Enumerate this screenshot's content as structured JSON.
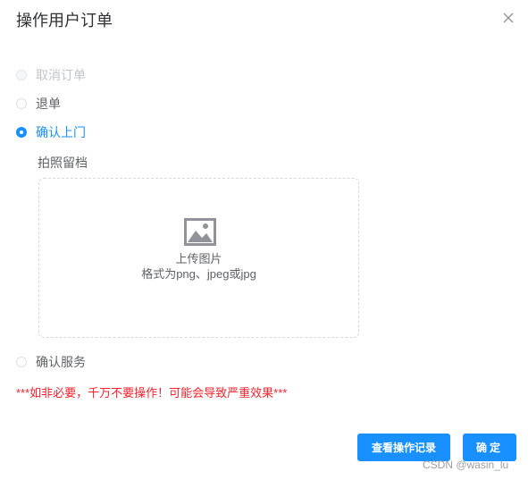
{
  "dialog": {
    "title": "操作用户订单",
    "close_icon": "close-icon"
  },
  "options": [
    {
      "label": "取消订单",
      "state": "disabled"
    },
    {
      "label": "退单",
      "state": "unchecked"
    },
    {
      "label": "确认上门",
      "state": "checked"
    },
    {
      "label": "确认服务",
      "state": "unchecked"
    }
  ],
  "photo": {
    "label": "拍照留档",
    "icon": "image-icon",
    "upload_text": "上传图片",
    "format_hint": "格式为png、jpeg或jpg"
  },
  "warning": "***如非必要，千万不要操作！可能会导致严重效果***",
  "buttons": {
    "view_log": "查看操作记录",
    "confirm": "确定"
  },
  "watermark": "CSDN @wasin_lu",
  "colors": {
    "primary": "#1890ff",
    "warning": "#f5222d",
    "disabled_text": "#c0c4cc",
    "text": "#606266"
  }
}
